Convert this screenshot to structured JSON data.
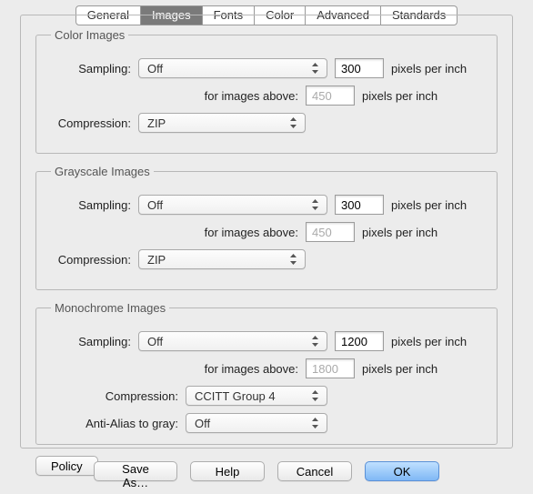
{
  "tabs": {
    "general": "General",
    "images": "Images",
    "fonts": "Fonts",
    "color": "Color",
    "advanced": "Advanced",
    "standards": "Standards"
  },
  "labels": {
    "sampling": "Sampling:",
    "compression": "Compression:",
    "forAbove": "for images above:",
    "ppi": "pixels per inch",
    "antialias": "Anti-Alias to gray:"
  },
  "groups": {
    "color": {
      "title": "Color Images",
      "sampling": "Off",
      "ppi": "300",
      "abovePpi": "450",
      "compression": "ZIP"
    },
    "gray": {
      "title": "Grayscale Images",
      "sampling": "Off",
      "ppi": "300",
      "abovePpi": "450",
      "compression": "ZIP"
    },
    "mono": {
      "title": "Monochrome Images",
      "sampling": "Off",
      "ppi": "1200",
      "abovePpi": "1800",
      "compression": "CCITT Group 4",
      "antialias": "Off"
    }
  },
  "buttons": {
    "policy": "Policy",
    "saveAs": "Save As…",
    "help": "Help",
    "cancel": "Cancel",
    "ok": "OK"
  }
}
